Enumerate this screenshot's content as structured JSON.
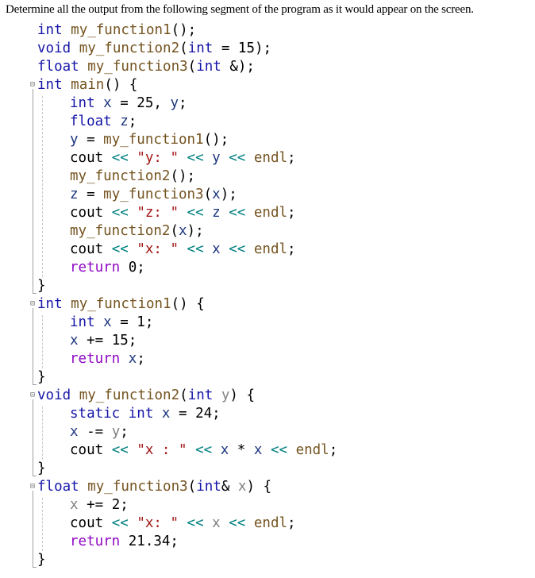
{
  "question": "Determine all the output from the following segment of the program as it would appear on the screen.",
  "code": {
    "lines": [
      {
        "indent": 0,
        "fold": false,
        "tokens": [
          [
            "kw",
            "int"
          ],
          [
            "pl",
            " "
          ],
          [
            "fn",
            "my_function1"
          ],
          [
            "pl",
            "();"
          ]
        ]
      },
      {
        "indent": 0,
        "fold": false,
        "tokens": [
          [
            "kw",
            "void"
          ],
          [
            "pl",
            " "
          ],
          [
            "fn",
            "my_function2"
          ],
          [
            "pl",
            "("
          ],
          [
            "kw",
            "int"
          ],
          [
            "pl",
            " = 15);"
          ]
        ]
      },
      {
        "indent": 0,
        "fold": false,
        "tokens": [
          [
            "kw",
            "float"
          ],
          [
            "pl",
            " "
          ],
          [
            "fn",
            "my_function3"
          ],
          [
            "pl",
            "("
          ],
          [
            "kw",
            "int"
          ],
          [
            "pl",
            " &);"
          ]
        ]
      },
      {
        "indent": 0,
        "fold": true,
        "tokens": [
          [
            "kw",
            "int"
          ],
          [
            "pl",
            " "
          ],
          [
            "fn",
            "main"
          ],
          [
            "pl",
            "() {"
          ]
        ]
      },
      {
        "indent": 1,
        "fold": false,
        "tokens": [
          [
            "kw",
            "int"
          ],
          [
            "pl",
            " "
          ],
          [
            "var",
            "x"
          ],
          [
            "pl",
            " = 25, "
          ],
          [
            "var",
            "y"
          ],
          [
            "pl",
            ";"
          ]
        ]
      },
      {
        "indent": 1,
        "fold": false,
        "tokens": [
          [
            "kw",
            "float"
          ],
          [
            "pl",
            " "
          ],
          [
            "var",
            "z"
          ],
          [
            "pl",
            ";"
          ]
        ]
      },
      {
        "indent": 1,
        "fold": false,
        "tokens": [
          [
            "var",
            "y"
          ],
          [
            "pl",
            " = "
          ],
          [
            "fn",
            "my_function1"
          ],
          [
            "pl",
            "();"
          ]
        ]
      },
      {
        "indent": 1,
        "fold": false,
        "tokens": [
          [
            "pl",
            "cout "
          ],
          [
            "op",
            "<<"
          ],
          [
            "pl",
            " "
          ],
          [
            "str",
            "\"y: \""
          ],
          [
            "pl",
            " "
          ],
          [
            "op",
            "<<"
          ],
          [
            "pl",
            " "
          ],
          [
            "var",
            "y"
          ],
          [
            "pl",
            " "
          ],
          [
            "op",
            "<<"
          ],
          [
            "pl",
            " "
          ],
          [
            "fn",
            "endl"
          ],
          [
            "pl",
            ";"
          ]
        ]
      },
      {
        "indent": 1,
        "fold": false,
        "tokens": [
          [
            "fn",
            "my_function2"
          ],
          [
            "pl",
            "();"
          ]
        ]
      },
      {
        "indent": 1,
        "fold": false,
        "tokens": [
          [
            "var",
            "z"
          ],
          [
            "pl",
            " = "
          ],
          [
            "fn",
            "my_function3"
          ],
          [
            "pl",
            "("
          ],
          [
            "var",
            "x"
          ],
          [
            "pl",
            ");"
          ]
        ]
      },
      {
        "indent": 1,
        "fold": false,
        "tokens": [
          [
            "pl",
            "cout "
          ],
          [
            "op",
            "<<"
          ],
          [
            "pl",
            " "
          ],
          [
            "str",
            "\"z: \""
          ],
          [
            "pl",
            " "
          ],
          [
            "op",
            "<<"
          ],
          [
            "pl",
            " "
          ],
          [
            "var",
            "z"
          ],
          [
            "pl",
            " "
          ],
          [
            "op",
            "<<"
          ],
          [
            "pl",
            " "
          ],
          [
            "fn",
            "endl"
          ],
          [
            "pl",
            ";"
          ]
        ]
      },
      {
        "indent": 1,
        "fold": false,
        "tokens": [
          [
            "fn",
            "my_function2"
          ],
          [
            "pl",
            "("
          ],
          [
            "var",
            "x"
          ],
          [
            "pl",
            ");"
          ]
        ]
      },
      {
        "indent": 1,
        "fold": false,
        "tokens": [
          [
            "pl",
            "cout "
          ],
          [
            "op",
            "<<"
          ],
          [
            "pl",
            " "
          ],
          [
            "str",
            "\"x: \""
          ],
          [
            "pl",
            " "
          ],
          [
            "op",
            "<<"
          ],
          [
            "pl",
            " "
          ],
          [
            "var",
            "x"
          ],
          [
            "pl",
            " "
          ],
          [
            "op",
            "<<"
          ],
          [
            "pl",
            " "
          ],
          [
            "fn",
            "endl"
          ],
          [
            "pl",
            ";"
          ]
        ]
      },
      {
        "indent": 1,
        "fold": false,
        "tokens": [
          [
            "ctl",
            "return"
          ],
          [
            "pl",
            " 0;"
          ]
        ]
      },
      {
        "indent": 0,
        "fold": false,
        "tokens": [
          [
            "pl",
            "}"
          ]
        ]
      },
      {
        "indent": 0,
        "fold": true,
        "tokens": [
          [
            "kw",
            "int"
          ],
          [
            "pl",
            " "
          ],
          [
            "fn",
            "my_function1"
          ],
          [
            "pl",
            "() {"
          ]
        ]
      },
      {
        "indent": 1,
        "fold": false,
        "tokens": [
          [
            "kw",
            "int"
          ],
          [
            "pl",
            " "
          ],
          [
            "var",
            "x"
          ],
          [
            "pl",
            " = 1;"
          ]
        ]
      },
      {
        "indent": 1,
        "fold": false,
        "tokens": [
          [
            "var",
            "x"
          ],
          [
            "pl",
            " += 15;"
          ]
        ]
      },
      {
        "indent": 1,
        "fold": false,
        "tokens": [
          [
            "ctl",
            "return"
          ],
          [
            "pl",
            " "
          ],
          [
            "var",
            "x"
          ],
          [
            "pl",
            ";"
          ]
        ]
      },
      {
        "indent": 0,
        "fold": false,
        "tokens": [
          [
            "pl",
            "}"
          ]
        ]
      },
      {
        "indent": 0,
        "fold": true,
        "tokens": [
          [
            "kw",
            "void"
          ],
          [
            "pl",
            " "
          ],
          [
            "fn",
            "my_function2"
          ],
          [
            "pl",
            "("
          ],
          [
            "kw",
            "int"
          ],
          [
            "pl",
            " "
          ],
          [
            "param",
            "y"
          ],
          [
            "pl",
            ") {"
          ]
        ]
      },
      {
        "indent": 1,
        "fold": false,
        "tokens": [
          [
            "kw",
            "static"
          ],
          [
            "pl",
            " "
          ],
          [
            "kw",
            "int"
          ],
          [
            "pl",
            " "
          ],
          [
            "var",
            "x"
          ],
          [
            "pl",
            " = 24;"
          ]
        ]
      },
      {
        "indent": 1,
        "fold": false,
        "tokens": [
          [
            "var",
            "x"
          ],
          [
            "pl",
            " -= "
          ],
          [
            "param",
            "y"
          ],
          [
            "pl",
            ";"
          ]
        ]
      },
      {
        "indent": 1,
        "fold": false,
        "tokens": [
          [
            "pl",
            "cout "
          ],
          [
            "op",
            "<<"
          ],
          [
            "pl",
            " "
          ],
          [
            "str",
            "\"x : \""
          ],
          [
            "pl",
            " "
          ],
          [
            "op",
            "<<"
          ],
          [
            "pl",
            " "
          ],
          [
            "var",
            "x"
          ],
          [
            "pl",
            " * "
          ],
          [
            "var",
            "x"
          ],
          [
            "pl",
            " "
          ],
          [
            "op",
            "<<"
          ],
          [
            "pl",
            " "
          ],
          [
            "fn",
            "endl"
          ],
          [
            "pl",
            ";"
          ]
        ]
      },
      {
        "indent": 0,
        "fold": false,
        "tokens": [
          [
            "pl",
            "}"
          ]
        ]
      },
      {
        "indent": 0,
        "fold": true,
        "tokens": [
          [
            "kw",
            "float"
          ],
          [
            "pl",
            " "
          ],
          [
            "fn",
            "my_function3"
          ],
          [
            "pl",
            "("
          ],
          [
            "kw",
            "int"
          ],
          [
            "pl",
            "& "
          ],
          [
            "param",
            "x"
          ],
          [
            "pl",
            ") {"
          ]
        ]
      },
      {
        "indent": 1,
        "fold": false,
        "tokens": [
          [
            "param",
            "x"
          ],
          [
            "pl",
            " += 2;"
          ]
        ]
      },
      {
        "indent": 1,
        "fold": false,
        "tokens": [
          [
            "pl",
            "cout "
          ],
          [
            "op",
            "<<"
          ],
          [
            "pl",
            " "
          ],
          [
            "str",
            "\"x: \""
          ],
          [
            "pl",
            " "
          ],
          [
            "op",
            "<<"
          ],
          [
            "pl",
            " "
          ],
          [
            "param",
            "x"
          ],
          [
            "pl",
            " "
          ],
          [
            "op",
            "<<"
          ],
          [
            "pl",
            " "
          ],
          [
            "fn",
            "endl"
          ],
          [
            "pl",
            ";"
          ]
        ]
      },
      {
        "indent": 1,
        "fold": false,
        "tokens": [
          [
            "ctl",
            "return"
          ],
          [
            "pl",
            " 21.34;"
          ]
        ]
      },
      {
        "indent": 0,
        "fold": false,
        "tokens": [
          [
            "pl",
            "}"
          ]
        ]
      }
    ],
    "blocks": [
      [
        3,
        14
      ],
      [
        15,
        19
      ],
      [
        20,
        24
      ],
      [
        25,
        29
      ]
    ]
  }
}
